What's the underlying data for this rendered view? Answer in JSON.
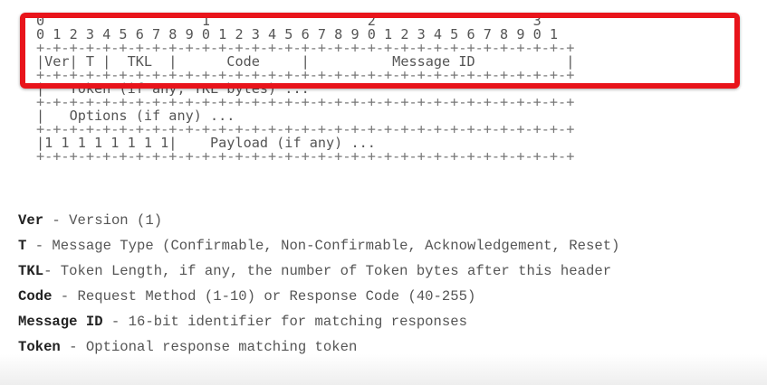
{
  "diagram": {
    "lines": [
      "0                   1                   2                   3",
      "0 1 2 3 4 5 6 7 8 9 0 1 2 3 4 5 6 7 8 9 0 1 2 3 4 5 6 7 8 9 0 1",
      "+-+-+-+-+-+-+-+-+-+-+-+-+-+-+-+-+-+-+-+-+-+-+-+-+-+-+-+-+-+-+-+-+",
      "|Ver| T |  TKL  |      Code     |          Message ID           |",
      "+-+-+-+-+-+-+-+-+-+-+-+-+-+-+-+-+-+-+-+-+-+-+-+-+-+-+-+-+-+-+-+-+",
      "|   Token (if any, TKL bytes) ...",
      "+-+-+-+-+-+-+-+-+-+-+-+-+-+-+-+-+-+-+-+-+-+-+-+-+-+-+-+-+-+-+-+-+",
      "|   Options (if any) ...",
      "+-+-+-+-+-+-+-+-+-+-+-+-+-+-+-+-+-+-+-+-+-+-+-+-+-+-+-+-+-+-+-+-+",
      "|1 1 1 1 1 1 1 1|    Payload (if any) ...",
      "+-+-+-+-+-+-+-+-+-+-+-+-+-+-+-+-+-+-+-+-+-+-+-+-+-+-+-+-+-+-+-+-+"
    ]
  },
  "legend": [
    {
      "term": "Ver",
      "desc": " - Version (1)"
    },
    {
      "term": "T",
      "desc": " - Message Type (Confirmable, Non-Confirmable, Acknowledgement, Reset)"
    },
    {
      "term": "TKL",
      "desc": "- Token Length, if any, the number of Token bytes after this header"
    },
    {
      "term": "Code",
      "desc": " - Request Method (1-10) or Response Code (40-255)"
    },
    {
      "term": "Message ID",
      "desc": " - 16-bit identifier for matching responses"
    },
    {
      "term": "Token",
      "desc": " - Optional response matching token"
    }
  ],
  "colors": {
    "highlight_border": "#e8141b",
    "text": "#555555",
    "term": "#222222"
  }
}
